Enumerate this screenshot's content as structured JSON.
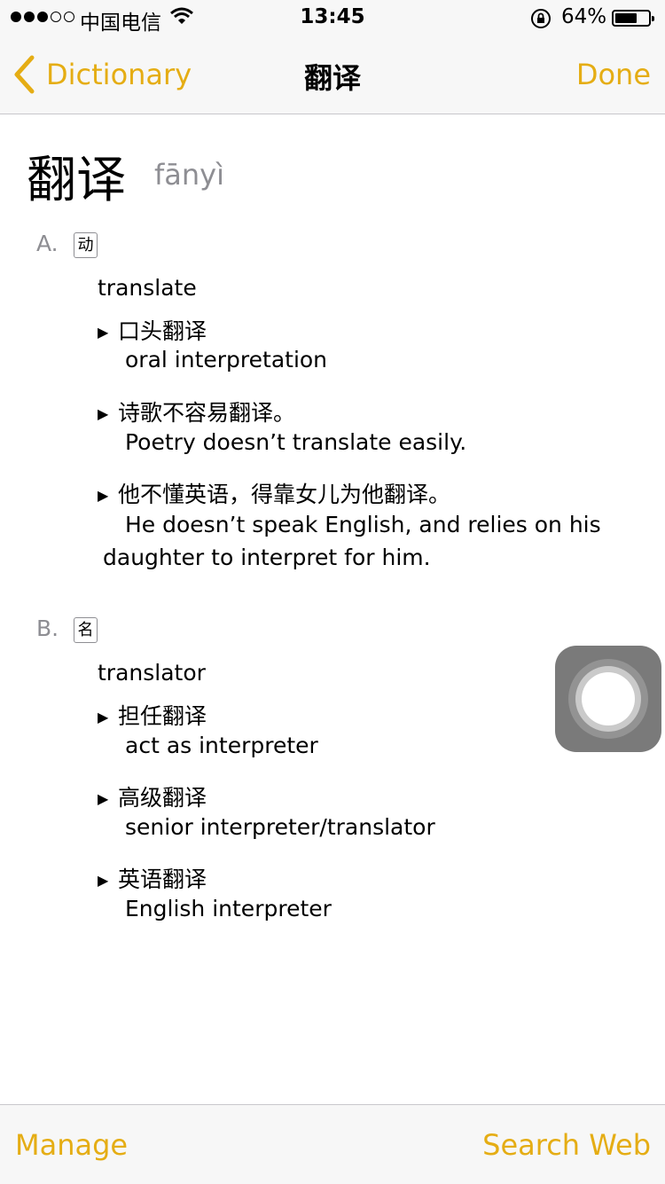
{
  "status_bar": {
    "carrier": "中国电信",
    "time": "13:45",
    "battery": "64%",
    "battery_level": 0.64,
    "signal_bars_filled": 3,
    "signal_bars_total": 5,
    "icons": [
      "wifi-icon",
      "rotation-lock-icon",
      "battery-icon"
    ]
  },
  "nav": {
    "back_label": "Dictionary",
    "title": "翻译",
    "done_label": "Done"
  },
  "entry": {
    "headword": "翻译",
    "pinyin": "fānyì",
    "senses": [
      {
        "letter": "A.",
        "pos": "动",
        "gloss": "translate",
        "examples": [
          {
            "zh": "口头翻译",
            "en": "oral interpretation"
          },
          {
            "zh": "诗歌不容易翻译。",
            "en": "Poetry doesn’t translate easily."
          },
          {
            "zh": "他不懂英语，得靠女儿为他翻译。",
            "en": "He doesn’t speak English, and relies on his daughter to interpret for him."
          }
        ]
      },
      {
        "letter": "B.",
        "pos": "名",
        "gloss": "translator",
        "examples": [
          {
            "zh": "担任翻译",
            "en": "act as interpreter"
          },
          {
            "zh": "高级翻译",
            "en": "senior interpreter/translator"
          },
          {
            "zh": "英语翻译",
            "en": "English interpreter"
          }
        ]
      }
    ]
  },
  "toolbar": {
    "manage_label": "Manage",
    "search_web_label": "Search Web"
  },
  "colors": {
    "accent": "#e5ad14",
    "secondary_text": "#8e8e93",
    "bar_background": "#f7f7f7"
  }
}
